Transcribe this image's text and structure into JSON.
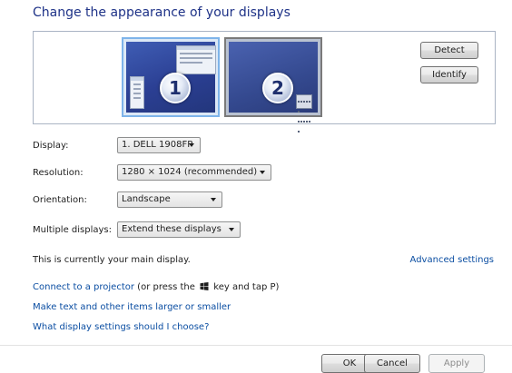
{
  "title": "Change the appearance of your displays",
  "monitors": [
    {
      "number": "1"
    },
    {
      "number": "2"
    }
  ],
  "buttons": {
    "detect": "Detect",
    "identify": "Identify",
    "ok": "OK",
    "cancel": "Cancel",
    "apply": "Apply"
  },
  "settings": {
    "display": {
      "label": "Display:",
      "value": "1. DELL 1908FP"
    },
    "resolution": {
      "label": "Resolution:",
      "value": "1280 × 1024 (recommended)"
    },
    "orientation": {
      "label": "Orientation:",
      "value": "Landscape"
    },
    "multiple": {
      "label": "Multiple displays:",
      "value": "Extend these displays"
    }
  },
  "status": "This is currently your main display.",
  "links": {
    "advanced": "Advanced settings",
    "projector": "Connect to a projector",
    "projector_prefix": " (or press the ",
    "projector_suffix": " key and tap P)",
    "text_size": "Make text and other items larger or smaller",
    "choose": "What display settings should I choose?"
  },
  "colors": {
    "title": "#1e3287",
    "link": "#0b4ea2",
    "selected_border": "#7eb4ea"
  },
  "icons": [
    "windows-logo-icon",
    "calculator-icon"
  ]
}
